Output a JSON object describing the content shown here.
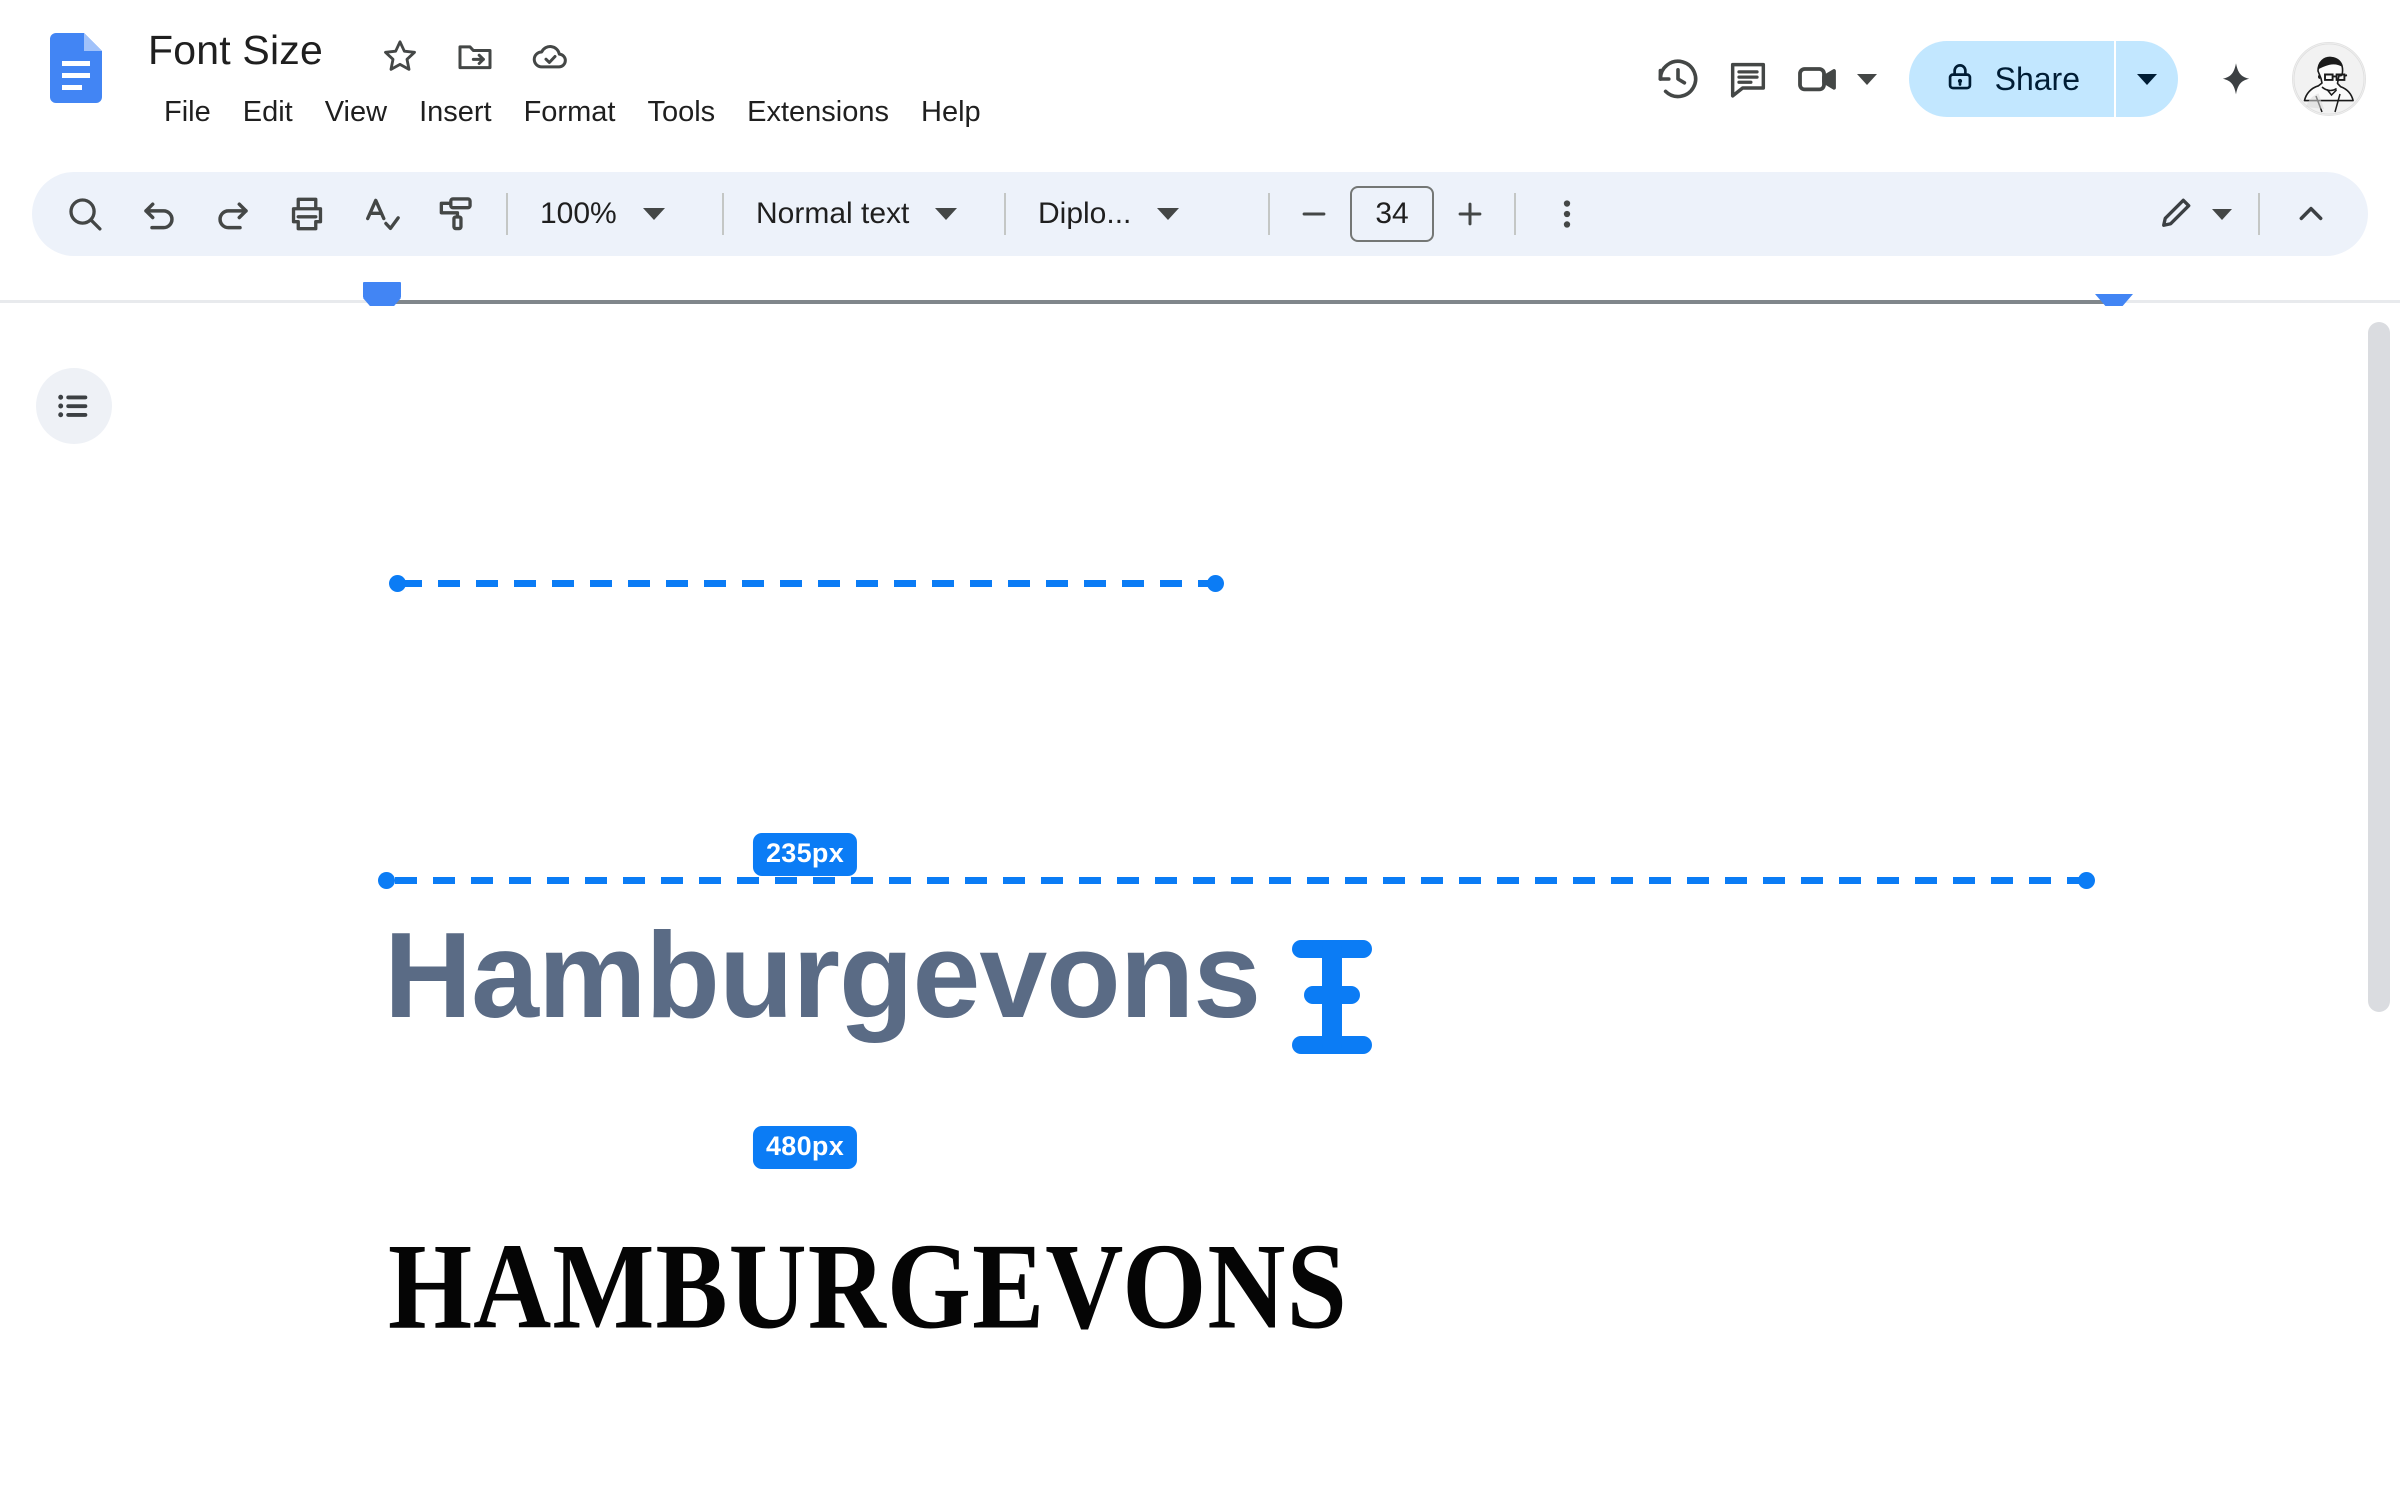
{
  "header": {
    "doc_icon": "google-docs-icon",
    "title": "Font Size",
    "title_icons": [
      {
        "name": "star-icon",
        "label": "Star"
      },
      {
        "name": "move-to-folder-icon",
        "label": "Move"
      },
      {
        "name": "cloud-saved-icon",
        "label": "Saved to Drive"
      }
    ],
    "menus": [
      {
        "label": "File"
      },
      {
        "label": "Edit"
      },
      {
        "label": "View"
      },
      {
        "label": "Insert"
      },
      {
        "label": "Format"
      },
      {
        "label": "Tools"
      },
      {
        "label": "Extensions"
      },
      {
        "label": "Help"
      }
    ],
    "right_icons": [
      {
        "name": "version-history-icon",
        "label": "Version history"
      },
      {
        "name": "comment-icon",
        "label": "Comments"
      },
      {
        "name": "meet-camera-icon",
        "label": "Join call"
      }
    ],
    "share": {
      "label": "Share",
      "lock_icon": "lock-icon",
      "caret_icon": "chevron-down-icon",
      "background": "#c2e7ff",
      "text_color": "#001d35"
    },
    "gemini_icon": "gemini-sparkle-icon",
    "avatar": "user-avatar"
  },
  "toolbar": {
    "icons": [
      {
        "name": "search-icon",
        "label": "Search"
      },
      {
        "name": "undo-icon",
        "label": "Undo"
      },
      {
        "name": "redo-icon",
        "label": "Redo"
      },
      {
        "name": "print-icon",
        "label": "Print"
      },
      {
        "name": "spellcheck-icon",
        "label": "Spelling and grammar check"
      },
      {
        "name": "paint-format-icon",
        "label": "Paint format"
      }
    ],
    "zoom": {
      "value": "100%",
      "caret": "chevron-down-icon"
    },
    "style": {
      "value": "Normal text",
      "caret": "chevron-down-icon"
    },
    "font": {
      "value": "Diplo...",
      "caret": "chevron-down-icon"
    },
    "font_size": {
      "decrease_label": "−",
      "value": "34",
      "increase_label": "+"
    },
    "more_icon": "more-vertical-icon",
    "mode": {
      "icon": "pencil-edit-icon",
      "caret": "chevron-down-icon"
    },
    "collapse_icon": "chevron-up-icon",
    "background": "#edf2fa"
  },
  "ruler": {
    "left_marker": "left-indent-marker",
    "right_marker": "right-indent-marker"
  },
  "document": {
    "outline_button": "show-outline-icon",
    "measurements": [
      {
        "label": "235px",
        "name": "measure-annotation-235"
      },
      {
        "label": "480px",
        "name": "measure-annotation-480"
      }
    ],
    "lines": [
      {
        "text": "Hamburgevons",
        "name": "sample-text-line-1",
        "color": "#5a6b85"
      },
      {
        "text": "HAMBURGEVONS",
        "name": "sample-text-line-2",
        "color": "#050505"
      }
    ],
    "cursor": "text-cursor-ibeam",
    "accent_color": "#0b7cf5"
  }
}
